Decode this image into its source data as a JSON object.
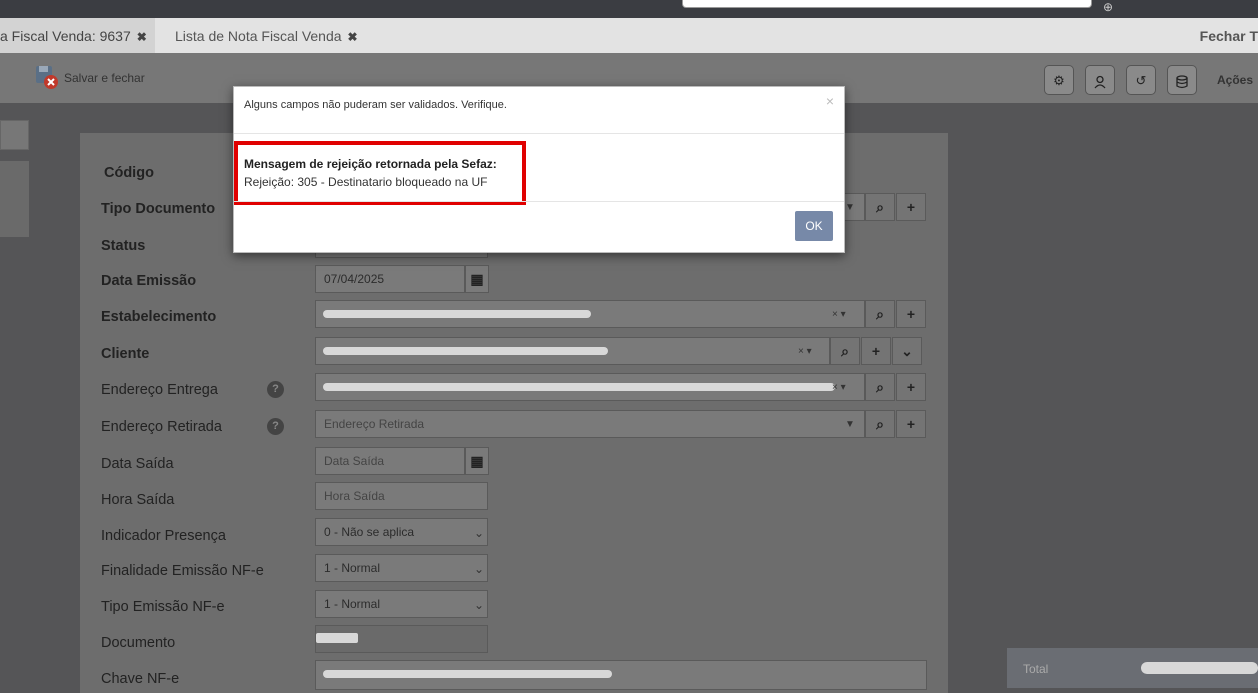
{
  "tabs": [
    {
      "label": "a Fiscal Venda: 9637",
      "close": "✖"
    },
    {
      "label": "Lista de Nota Fiscal Venda",
      "close": "✖"
    }
  ],
  "fechar_label": "Fechar T",
  "toolbar": {
    "save_label": "Salvar e fechar",
    "icons": [
      "gear-icon",
      "user-icon",
      "history-icon",
      "database-icon"
    ],
    "acoes_label": "Ações"
  },
  "form": {
    "labels": {
      "codigo": "Código",
      "tipo_documento": "Tipo Documento",
      "status": "Status",
      "data_emissao": "Data Emissão",
      "estabelecimento": "Estabelecimento",
      "cliente": "Cliente",
      "endereco_entrega": "Endereço Entrega",
      "endereco_retirada": "Endereço Retirada",
      "data_saida": "Data Saída",
      "hora_saida": "Hora Saída",
      "indicador_presenca": "Indicador Presença",
      "finalidade_emissao": "Finalidade Emissão NF-e",
      "tipo_emissao": "Tipo Emissão NF-e",
      "documento": "Documento",
      "chave_nfe": "Chave NF-e"
    },
    "values": {
      "data_emissao": "07/04/2025",
      "endereco_retirada_placeholder": "Endereço Retirada",
      "data_saida_placeholder": "Data Saída",
      "hora_saida_placeholder": "Hora Saída",
      "indicador_presenca": "0 - Não se aplica",
      "finalidade_emissao": "1 - Normal",
      "tipo_emissao": "1 - Normal"
    },
    "help_glyph": "?"
  },
  "total_label": "Total",
  "dialog": {
    "title": "Alguns campos não puderam ser validados. Verifique.",
    "close": "×",
    "heading": "Mensagem de rejeição retornada pela Sefaz:",
    "message": "Rejeição: 305 - Destinatario bloqueado na UF",
    "ok_label": "OK"
  }
}
